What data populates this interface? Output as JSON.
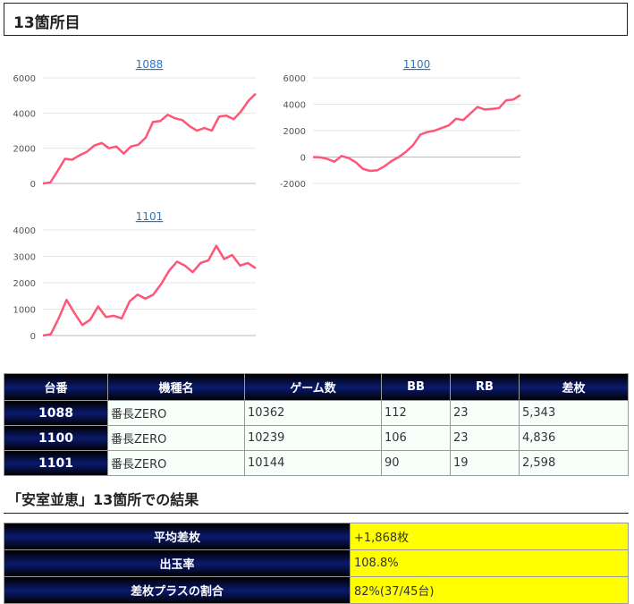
{
  "header": {
    "title": "13箇所目"
  },
  "chart_data": [
    {
      "type": "line",
      "title": "1088",
      "ylim": [
        0,
        6000
      ],
      "yticks": [
        0,
        2000,
        4000,
        6000
      ],
      "color": "#ff5577",
      "values": [
        0,
        50,
        700,
        1400,
        1350,
        1600,
        1800,
        2150,
        2300,
        2000,
        2100,
        1700,
        2100,
        2200,
        2600,
        3500,
        3550,
        3900,
        3700,
        3600,
        3250,
        3000,
        3150,
        3000,
        3800,
        3850,
        3650,
        4100,
        4700,
        5100
      ]
    },
    {
      "type": "line",
      "title": "1100",
      "ylim": [
        -2000,
        6000
      ],
      "yticks": [
        -2000,
        0,
        2000,
        4000,
        6000
      ],
      "color": "#ff5577",
      "values": [
        0,
        -20,
        -150,
        -350,
        80,
        -80,
        -400,
        -900,
        -1050,
        -1000,
        -700,
        -300,
        0,
        400,
        900,
        1700,
        1900,
        2000,
        2200,
        2400,
        2900,
        2800,
        3300,
        3800,
        3600,
        3650,
        3700,
        4300,
        4350,
        4700
      ]
    },
    {
      "type": "line",
      "title": "1101",
      "ylim": [
        0,
        4000
      ],
      "yticks": [
        0,
        1000,
        2000,
        3000,
        4000
      ],
      "color": "#ff5577",
      "values": [
        0,
        50,
        650,
        1350,
        850,
        400,
        600,
        1100,
        700,
        750,
        650,
        1300,
        1550,
        1400,
        1550,
        1950,
        2450,
        2800,
        2650,
        2400,
        2750,
        2850,
        3400,
        2900,
        3050,
        2650,
        2750,
        2550
      ]
    }
  ],
  "table": {
    "headers": [
      "台番",
      "機種名",
      "ゲーム数",
      "BB",
      "RB",
      "差枚"
    ],
    "rows": [
      [
        "1088",
        "番長ZERO",
        "10362",
        "112",
        "23",
        "5,343"
      ],
      [
        "1100",
        "番長ZERO",
        "10239",
        "106",
        "23",
        "4,836"
      ],
      [
        "1101",
        "番長ZERO",
        "10144",
        "90",
        "19",
        "2,598"
      ]
    ]
  },
  "summary": {
    "title": "「安室並恵」13箇所での結果",
    "rows": [
      [
        "平均差枚",
        "+1,868枚"
      ],
      [
        "出玉率",
        "108.8%"
      ],
      [
        "差枚プラスの割合",
        "82%(37/45台)"
      ]
    ]
  }
}
